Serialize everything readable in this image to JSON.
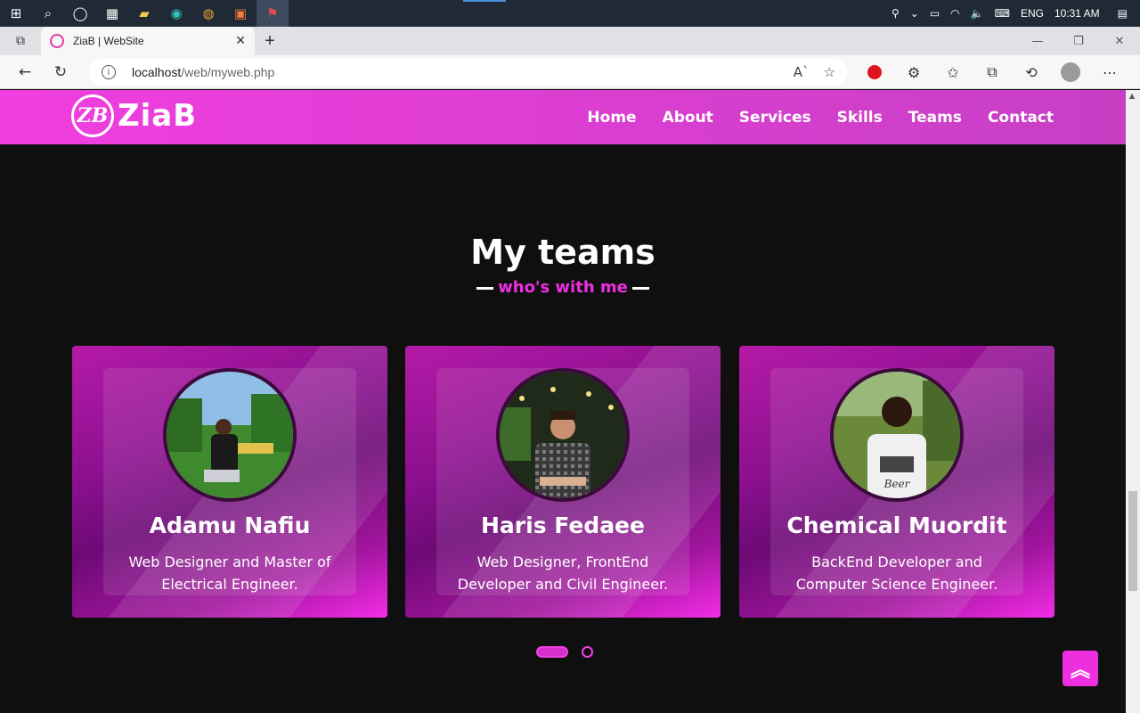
{
  "taskbar": {
    "icons": [
      "windows-icon",
      "search-icon",
      "cortana-icon",
      "task-view-icon",
      "file-explorer-icon",
      "edge-icon",
      "chrome-icon",
      "xampp-icon",
      "app-icon"
    ],
    "language": "ENG",
    "time": "10:31 AM"
  },
  "browser": {
    "tab_title": "ZiaB | WebSite",
    "url_host": "localhost",
    "url_path": "/web/myweb.php"
  },
  "site": {
    "logo_mark": "ZB",
    "logo_text": "ZiaB",
    "nav": [
      "Home",
      "About",
      "Services",
      "Skills",
      "Teams",
      "Contact"
    ],
    "colors": {
      "accent": "#ee2fe0",
      "background": "#0f0f0f"
    }
  },
  "teams": {
    "title": "My teams",
    "subtitle": "who's with me",
    "members": [
      {
        "name": "Adamu Nafiu",
        "role": "Web Designer and Master of Electrical Engineer."
      },
      {
        "name": "Haris Fedaee",
        "role": "Web Designer, FrontEnd Developer and Civil Engineer."
      },
      {
        "name": "Chemical Muordit",
        "role": "BackEnd Developer and Computer Science Engineer."
      }
    ]
  },
  "scroll_top_icon": "chevron-up-double-icon"
}
